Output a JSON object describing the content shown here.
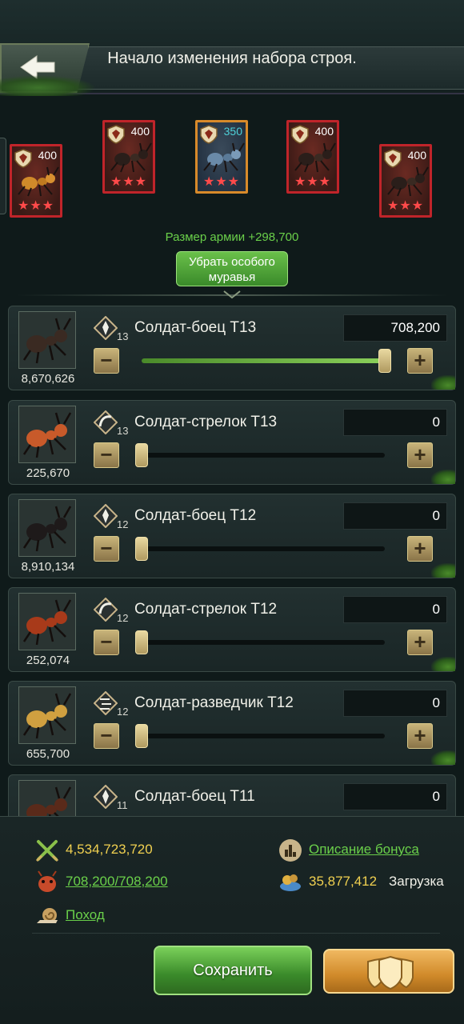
{
  "header": {
    "title": "Начало изменения набора строя."
  },
  "slots": [
    {
      "num": "400",
      "stars": "★★★",
      "special": false
    },
    {
      "num": "400",
      "stars": "★★★",
      "special": false
    },
    {
      "num": "350",
      "stars": "★★★",
      "special": true
    },
    {
      "num": "400",
      "stars": "★★★",
      "special": false
    },
    {
      "num": "400",
      "stars": "★★★",
      "special": false
    }
  ],
  "army_size": "Размер армии +298,700",
  "remove_special_button": "Убрать особого муравья",
  "troops": [
    {
      "name": "Солдат-боец T13",
      "tier": "13",
      "count": "8,670,626",
      "qty": "708,200",
      "level": 1.0,
      "type": "fighter"
    },
    {
      "name": "Солдат-стрелок T13",
      "tier": "13",
      "count": "225,670",
      "qty": "0",
      "level": 0.0,
      "type": "shooter"
    },
    {
      "name": "Солдат-боец T12",
      "tier": "12",
      "count": "8,910,134",
      "qty": "0",
      "level": 0.0,
      "type": "fighter"
    },
    {
      "name": "Солдат-стрелок T12",
      "tier": "12",
      "count": "252,074",
      "qty": "0",
      "level": 0.0,
      "type": "shooter"
    },
    {
      "name": "Солдат-разведчик T12",
      "tier": "12",
      "count": "655,700",
      "qty": "0",
      "level": 0.0,
      "type": "scout"
    },
    {
      "name": "Солдат-боец T11",
      "tier": "11",
      "count": "",
      "qty": "0",
      "level": 0.0,
      "type": "fighter"
    }
  ],
  "stats": {
    "power": "4,534,723,720",
    "troops": "708,200/708,200",
    "march": "Поход",
    "bonus_link": "Описание бонуса",
    "load_value": "35,877,412",
    "load_label": "Загрузка"
  },
  "buttons": {
    "save": "Сохранить",
    "minus": "−",
    "plus": "+"
  },
  "colors": {
    "accent_green": "#6ad04a",
    "slot_red": "#c0242a",
    "gold": "#d08a2a"
  }
}
